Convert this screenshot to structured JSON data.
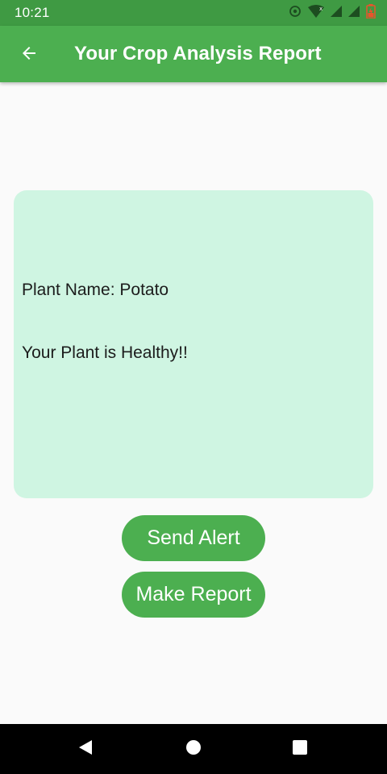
{
  "status_bar": {
    "time": "10:21",
    "icons": [
      "sync-icon",
      "wifi-icon",
      "signal-icon",
      "signal-icon",
      "battery-charging-icon"
    ]
  },
  "app_bar": {
    "title": "Your Crop Analysis Report",
    "back_icon": "arrow-back-icon"
  },
  "result": {
    "plant_name": "Plant Name: Potato",
    "status": "Your Plant is Healthy!!"
  },
  "actions": {
    "send_alert_label": "Send Alert",
    "make_report_label": "Make Report"
  },
  "navigation_bar": {
    "icons": [
      "nav-back-icon",
      "nav-home-icon",
      "nav-recents-icon"
    ]
  },
  "colors": {
    "primary": "#4caf50",
    "primary_dark": "#3f9a43",
    "card_background": "#cff5e2",
    "page_background": "#fafafa"
  }
}
